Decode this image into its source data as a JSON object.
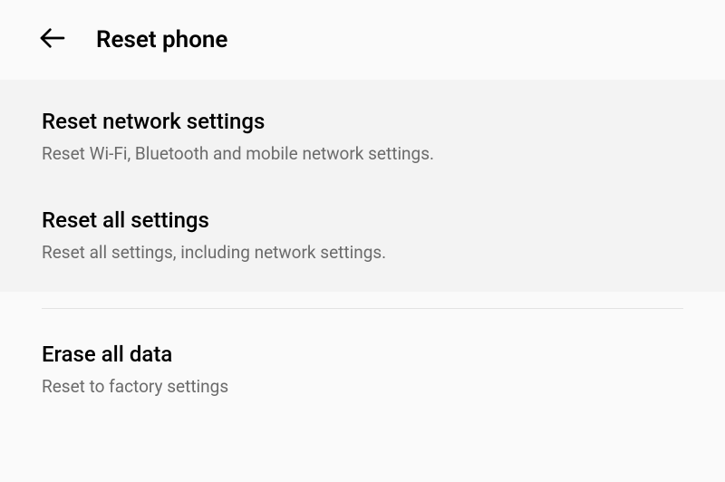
{
  "header": {
    "title": "Reset phone"
  },
  "options": {
    "reset_network": {
      "title": "Reset network settings",
      "subtitle": "Reset Wi-Fi, Bluetooth and mobile network settings."
    },
    "reset_all": {
      "title": "Reset all settings",
      "subtitle": "Reset all settings, including network settings."
    },
    "erase_all": {
      "title": "Erase all data",
      "subtitle": "Reset to factory settings"
    }
  }
}
